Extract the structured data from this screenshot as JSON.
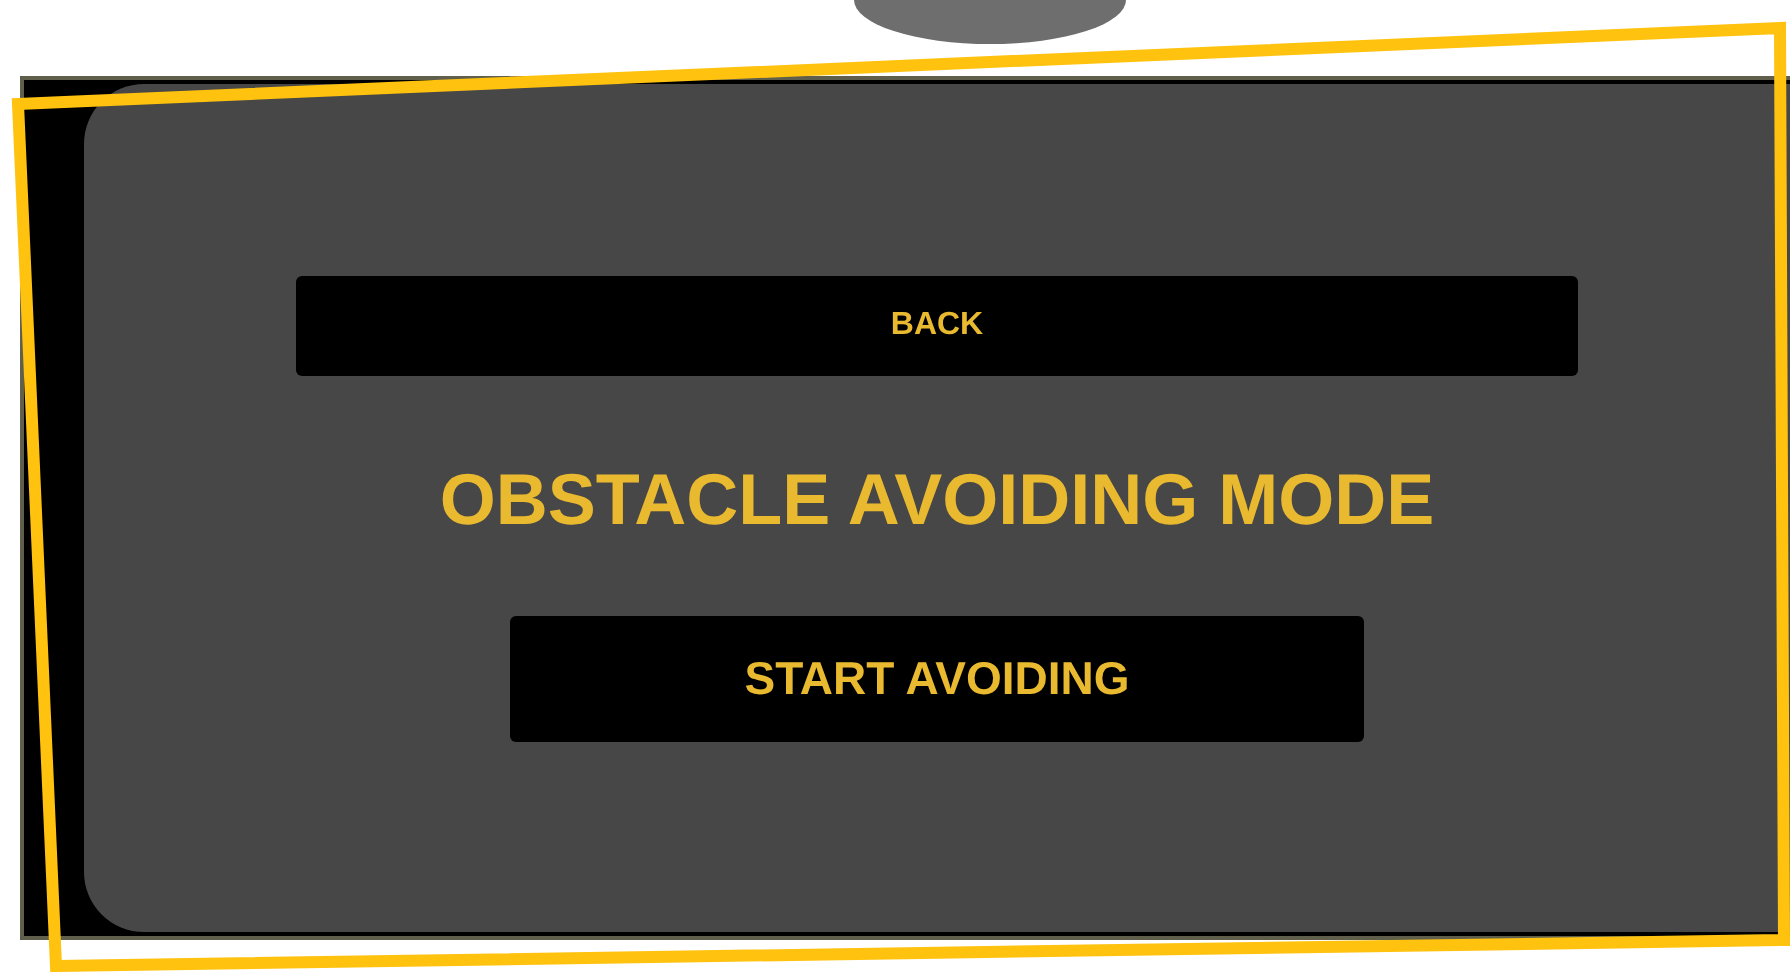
{
  "back_button": {
    "label": "BACK"
  },
  "title": "OBSTACLE AVOIDING MODE",
  "start_button": {
    "label": "START AVOIDING"
  }
}
